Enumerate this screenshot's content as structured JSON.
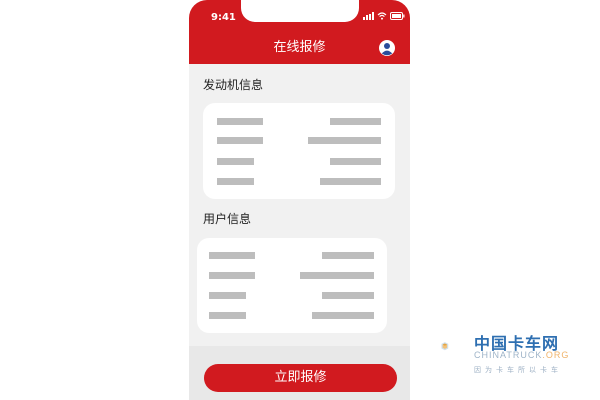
{
  "status_bar": {
    "time": "9:41"
  },
  "header": {
    "title": "在线报修"
  },
  "sections": {
    "engine": {
      "label": "发动机信息"
    },
    "user": {
      "label": "用户信息"
    }
  },
  "actions": {
    "submit_label": "立即报修"
  },
  "watermark": {
    "name": "中国卡车网",
    "site_main": "CHINATRUCK",
    "site_suffix": ".ORG",
    "slogan": "因为卡车所以卡车"
  },
  "colors": {
    "brand_red": "#d11a1f",
    "placeholder_gray": "#bdbdbd"
  },
  "icons": {
    "avatar": "user-avatar-icon",
    "wifi": "wifi-icon",
    "battery": "battery-icon",
    "signal": "signal-icon"
  }
}
